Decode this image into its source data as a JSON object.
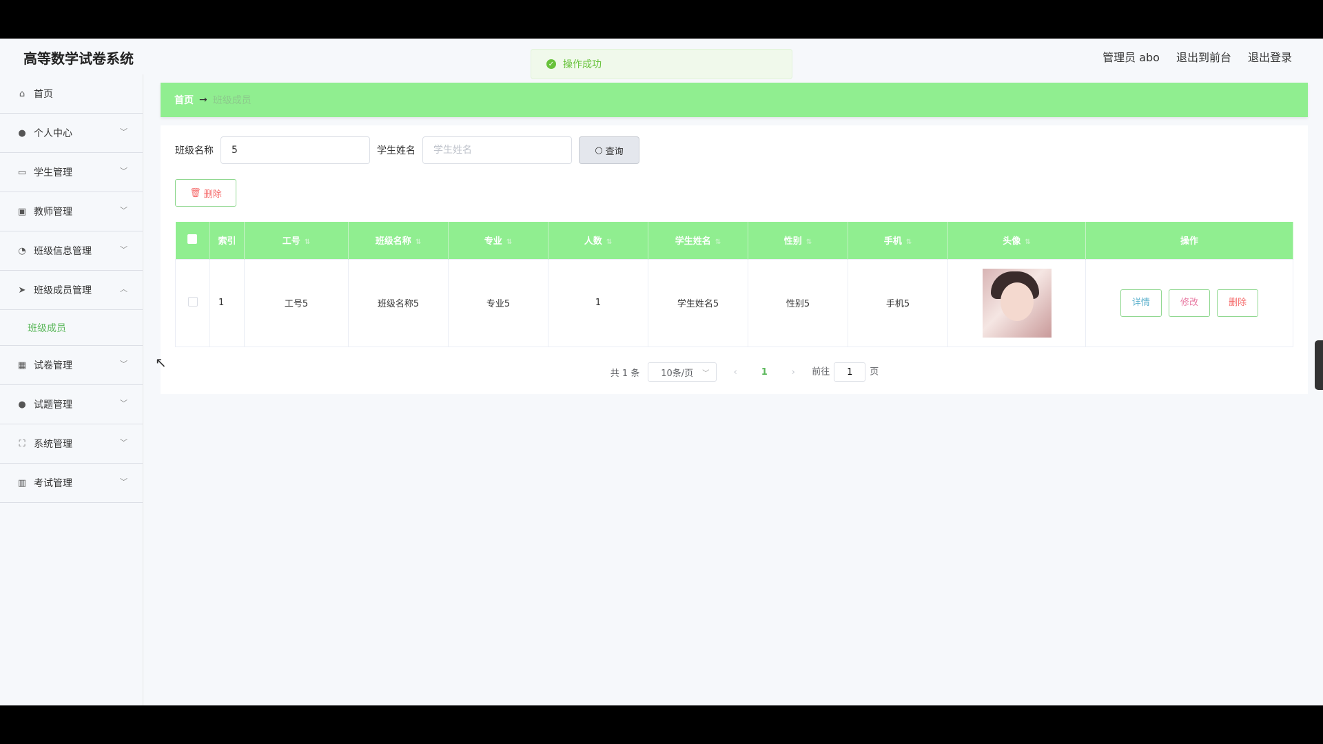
{
  "app_title": "高等数学试卷系统",
  "header": {
    "user": "管理员 abo",
    "to_front": "退出到前台",
    "logout": "退出登录"
  },
  "toast": {
    "message": "操作成功"
  },
  "sidebar": {
    "items": [
      {
        "label": "首页",
        "icon": "home-icon"
      },
      {
        "label": "个人中心",
        "icon": "user-icon"
      },
      {
        "label": "学生管理",
        "icon": "id-card-icon"
      },
      {
        "label": "教师管理",
        "icon": "clipboard-icon"
      },
      {
        "label": "班级信息管理",
        "icon": "gauge-icon"
      },
      {
        "label": "班级成员管理",
        "icon": "send-icon",
        "expanded": true
      },
      {
        "label": "试卷管理",
        "icon": "grid-icon"
      },
      {
        "label": "试题管理",
        "icon": "user-icon"
      },
      {
        "label": "系统管理",
        "icon": "fullscreen-icon"
      },
      {
        "label": "考试管理",
        "icon": "bar-chart-icon"
      }
    ],
    "sub_item": "班级成员"
  },
  "breadcrumb": {
    "home": "首页",
    "current": "班级成员"
  },
  "search": {
    "class_label": "班级名称",
    "class_value": "5",
    "student_label": "学生姓名",
    "student_placeholder": "学生姓名",
    "query_button": "查询"
  },
  "delete_button": "删除",
  "table": {
    "headers": [
      "索引",
      "工号",
      "班级名称",
      "专业",
      "人数",
      "学生姓名",
      "性别",
      "手机",
      "头像",
      "操作"
    ],
    "rows": [
      {
        "index": "1",
        "job_no": "工号5",
        "class_name": "班级名称5",
        "major": "专业5",
        "count": "1",
        "student_name": "学生姓名5",
        "gender": "性别5",
        "phone": "手机5"
      }
    ],
    "actions": {
      "detail": "详情",
      "edit": "修改",
      "delete": "删除"
    }
  },
  "pagination": {
    "total": "共 1 条",
    "page_size": "10条/页",
    "current_page": "1",
    "goto_label": "前往",
    "goto_value": "1",
    "page_suffix": "页"
  },
  "colors": {
    "accent": "#90ee90",
    "danger": "#f56c6c",
    "success": "#67c23a"
  }
}
